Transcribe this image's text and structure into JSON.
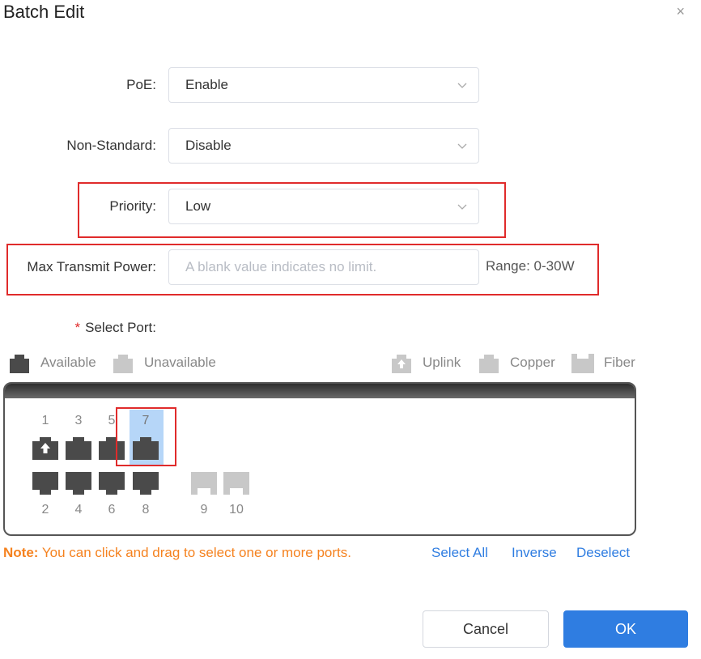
{
  "dialog": {
    "title": "Batch Edit",
    "close_glyph": "×"
  },
  "form": {
    "poe": {
      "label": "PoE:",
      "value": "Enable"
    },
    "non_standard": {
      "label": "Non-Standard:",
      "value": "Disable"
    },
    "priority": {
      "label": "Priority:",
      "value": "Low"
    },
    "max_power": {
      "label": "Max Transmit Power:",
      "value": "",
      "placeholder": "A blank value indicates no limit.",
      "range": "Range: 0-30W"
    },
    "select_port": {
      "required_mark": "*",
      "label": "Select Port:"
    }
  },
  "legend": {
    "available": "Available",
    "unavailable": "Unavailable",
    "uplink": "Uplink",
    "copper": "Copper",
    "fiber": "Fiber"
  },
  "ports": {
    "top": [
      {
        "number": "1",
        "type": "uplink",
        "selected": false
      },
      {
        "number": "3",
        "type": "copper",
        "selected": false
      },
      {
        "number": "5",
        "type": "copper",
        "selected": false
      },
      {
        "number": "7",
        "type": "copper",
        "selected": true
      }
    ],
    "bottom": [
      {
        "number": "2",
        "type": "copper"
      },
      {
        "number": "4",
        "type": "copper"
      },
      {
        "number": "6",
        "type": "copper"
      },
      {
        "number": "8",
        "type": "copper"
      },
      {
        "number": "9",
        "type": "fiber-unavailable"
      },
      {
        "number": "10",
        "type": "fiber-unavailable"
      }
    ]
  },
  "note": {
    "prefix": "Note:",
    "text": " You can click and drag to select one or more ports."
  },
  "actions": {
    "select_all": "Select All",
    "inverse": "Inverse",
    "deselect": "Deselect",
    "cancel": "Cancel",
    "ok": "OK"
  },
  "colors": {
    "accent": "#2f7de1",
    "highlight": "#e02b2b",
    "note": "#f5821f",
    "port_available": "#4a4a4a",
    "port_unavailable": "#c8c8c8",
    "port_selected_bg": "#b6d6f8"
  },
  "icons": {
    "chevron": "chevron-down-icon",
    "uplink": "uplink-port-icon",
    "copper": "copper-port-icon",
    "fiber": "fiber-port-icon"
  }
}
